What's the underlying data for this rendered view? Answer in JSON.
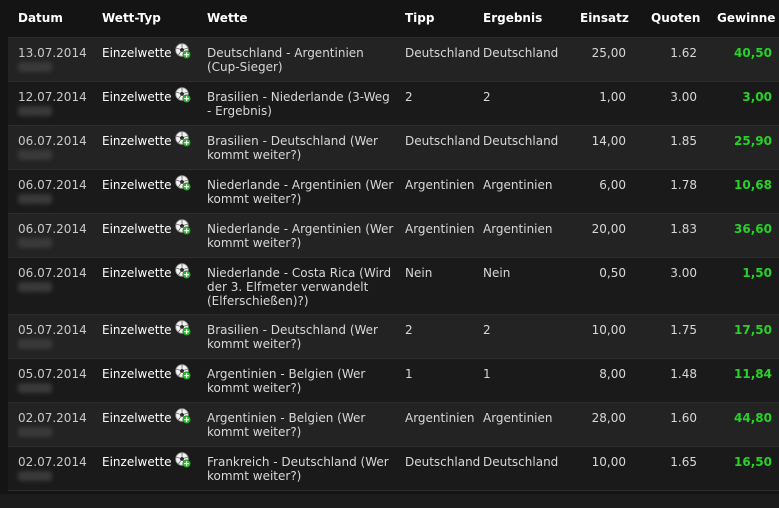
{
  "headers": {
    "datum": "Datum",
    "wetttyp": "Wett-Typ",
    "wette": "Wette",
    "tipp": "Tipp",
    "ergebnis": "Ergebnis",
    "einsatz": "Einsatz",
    "quoten": "Quoten",
    "gewinn": "Gewinne"
  },
  "icons": {
    "bet_type": "soccer-ball-plus-icon"
  },
  "colors": {
    "gewinn": "#27d327",
    "header_text": "#ffffff"
  },
  "rows": [
    {
      "datum": "13.07.2014",
      "typ": "Einzelwette",
      "wette": "Deutschland - Argentinien (Cup-Sieger)",
      "tipp": "Deutschland",
      "ergebnis": "Deutschland",
      "einsatz": "25,00",
      "quote": "1.62",
      "gewinn": "40,50"
    },
    {
      "datum": "12.07.2014",
      "typ": "Einzelwette",
      "wette": "Brasilien - Niederlande (3-Weg - Ergebnis)",
      "tipp": "2",
      "ergebnis": "2",
      "einsatz": "1,00",
      "quote": "3.00",
      "gewinn": "3,00"
    },
    {
      "datum": "06.07.2014",
      "typ": "Einzelwette",
      "wette": "Brasilien - Deutschland (Wer kommt weiter?)",
      "tipp": "Deutschland",
      "ergebnis": "Deutschland",
      "einsatz": "14,00",
      "quote": "1.85",
      "gewinn": "25,90"
    },
    {
      "datum": "06.07.2014",
      "typ": "Einzelwette",
      "wette": "Niederlande - Argentinien (Wer kommt weiter?)",
      "tipp": "Argentinien",
      "ergebnis": "Argentinien",
      "einsatz": "6,00",
      "quote": "1.78",
      "gewinn": "10,68"
    },
    {
      "datum": "06.07.2014",
      "typ": "Einzelwette",
      "wette": "Niederlande - Argentinien (Wer kommt weiter?)",
      "tipp": "Argentinien",
      "ergebnis": "Argentinien",
      "einsatz": "20,00",
      "quote": "1.83",
      "gewinn": "36,60"
    },
    {
      "datum": "06.07.2014",
      "typ": "Einzelwette",
      "wette": "Niederlande - Costa Rica (Wird der 3. Elfmeter verwandelt (Elferschießen)?)",
      "tipp": "Nein",
      "ergebnis": "Nein",
      "einsatz": "0,50",
      "quote": "3.00",
      "gewinn": "1,50"
    },
    {
      "datum": "05.07.2014",
      "typ": "Einzelwette",
      "wette": "Brasilien - Deutschland (Wer kommt weiter?)",
      "tipp": "2",
      "ergebnis": "2",
      "einsatz": "10,00",
      "quote": "1.75",
      "gewinn": "17,50"
    },
    {
      "datum": "05.07.2014",
      "typ": "Einzelwette",
      "wette": "Argentinien - Belgien (Wer kommt weiter?)",
      "tipp": "1",
      "ergebnis": "1",
      "einsatz": "8,00",
      "quote": "1.48",
      "gewinn": "11,84"
    },
    {
      "datum": "02.07.2014",
      "typ": "Einzelwette",
      "wette": "Argentinien - Belgien (Wer kommt weiter?)",
      "tipp": "Argentinien",
      "ergebnis": "Argentinien",
      "einsatz": "28,00",
      "quote": "1.60",
      "gewinn": "44,80"
    },
    {
      "datum": "02.07.2014",
      "typ": "Einzelwette",
      "wette": "Frankreich - Deutschland (Wer kommt weiter?)",
      "tipp": "Deutschland",
      "ergebnis": "Deutschland",
      "einsatz": "10,00",
      "quote": "1.65",
      "gewinn": "16,50"
    }
  ]
}
